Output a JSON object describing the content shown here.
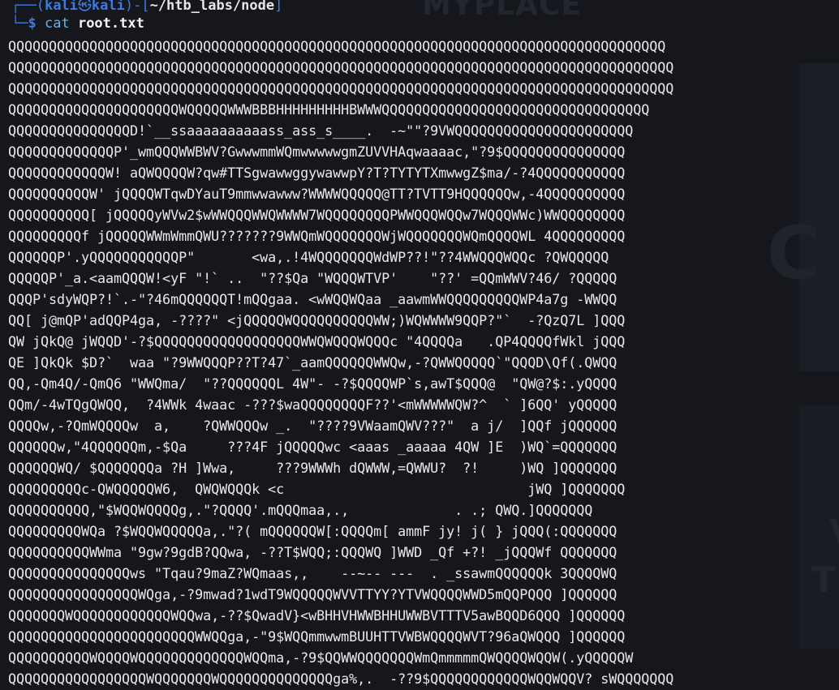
{
  "wallpaper": {
    "brand": "MYPLACE",
    "fragment_1": "C",
    "fragment_2": "V",
    "fragment_3": "TP"
  },
  "prompt": {
    "open_bracket": "┌──(",
    "user": "kali",
    "at_symbol": "㉿",
    "host": "kali",
    "mid_bracket": ")-[",
    "cwd": "~/htb_labs/node",
    "close_bracket": "]",
    "corner": "└─",
    "dollar": "$",
    "command": "cat",
    "argument": "root.txt"
  },
  "output_lines": [
    "QQQQQQQQQQQQQQQQQQQQQQQQQQQQQQQQQQQQQQQQQQQQQQQQQQQQQQQQQQQQQQQQQQQQQQQQQQQQQQQQQ",
    "QQQQQQQQQQQQQQQQQQQQQQQQQQQQQQQQQQQQQQQQQQQQQQQQQQQQQQQQQQQQQQQQQQQQQQQQQQQQQQQQQQ",
    "QQQQQQQQQQQQQQQQQQQQQQQQQQQQQQQQQQQQQQQQQQQQQQQQQQQQQQQQQQQQQQQQQQQQQQQQQQQQQQQQQQ",
    "QQQQQQQQQQQQQQQQQQQQQWQQQQQWWWBBBHHHHHHHHHBWWWQQQQQQQQQQQQQQQQQQQQQQQQQQQQQQQQQ",
    "QQQQQQQQQQQQQQQD!`__ssaaaaaaaaaass_ass_s____.  -~\"\"?9VWQQQQQQQQQQQQQQQQQQQQQQ",
    "QQQQQQQQQQQQQP'_wmQQQWWBWV?GwwwmmWQmwwwwwgmZUVVHAqwaaaac,\"?9$QQQQQQQQQQQQQQQ",
    "QQQQQQQQQQQQW! aQWQQQQW?qw#TTSgwawwggywawwpY?T?TYTYTXmwwgZ$ma/-?4QQQQQQQQQQQ",
    "QQQQQQQQQQW' jQQQQWTqwDYauT9mmwwawww?WWWWQQQQQ@TT?TVTT9HQQQQQQw,-4QQQQQQQQQQ",
    "QQQQQQQQQQ[ jQQQQQyWVw2$wWWQQQWWQWWWW7WQQQQQQQQPWWQQQWQQw7WQQQWWc)WWQQQQQQQQ",
    "QQQQQQQQQf jQQQQQWWmWmmQWU???????9WWQmWQQQQQQQWjWQQQQQQQWQmQQQQWL 4QQQQQQQQQ",
    "QQQQQQP'.yQQQQQQQQQQQP\"       <wa,.!4WQQQQQQQWdWP??!\"??4WWQQQWQQc ?QWQQQQQ",
    "QQQQQP'_a.<aamQQQW!<yF \"!` ..  \"??$Qa \"WQQQWTVP'    \"??' =QQmWWV?46/ ?QQQQQ",
    "QQQP'sdyWQP?!`.-\"?46mQQQQQQT!mQQgaa. <wWQQWQaa _aawmWWQQQQQQQQQWP4a7g -WWQQ",
    "QQ[ j@mQP'adQQP4ga, -????\" <jQQQQQWQQQQQQQQQQWW;)WQWWWW9QQP?\"`  -?QzQ7L ]QQQ",
    "QW jQkQ@ jWQQD'-?$QQQQQQQQQQQQQQQQQQWWQWQQQWQQQc \"4QQQQa   .QP4QQQQfWkl jQQQ",
    "QE ]QkQk $D?`  waa \"?9WWQQQP??T?47`_aamQQQQQQWWQw,-?QWWQQQQQ`\"QQQD\\Qf(.QWQQ",
    "QQ,-Qm4Q/-QmQ6 \"WWQma/  \"??QQQQQQL 4W\"- -?$QQQQWP`s,awT$QQQ@  \"QW@?$:.yQQQQ",
    "QQm/-4wTQgQWQQ,  ?4WWk 4waac -???$waQQQQQQQQF??'<mWWWWWQW?^  ` ]6QQ' yQQQQQ",
    "QQQQw,-?QmWQQQQw  a,    ?QWWQQQw _.  \"????9VWaamQWV???\"  a j/  ]QQf jQQQQQQ",
    "QQQQQQw,\"4QQQQQQm,-$Qa     ???4F jQQQQQwc <aaas _aaaaa 4QW ]E  )WQ`=QQQQQQQ",
    "QQQQQQWQ/ $QQQQQQQa ?H ]Wwa,     ???9WWWh dQWWW,=QWWU?  ?!     )WQ ]QQQQQQQ",
    "QQQQQQQQQc-QWQQQQQW6,  QWQWQQQk <c                              jWQ ]QQQQQQQ",
    "QQQQQQQQQQ,\"$WQQWQQQQg,.\"?QQQQ'.mQQQmaa,.,             . .; QWQ.]QQQQQQQ",
    "QQQQQQQQQWQa ?$WQQWQQQQQa,.\"?( mQQQQQQW[:QQQQm[ ammF jy! j( } jQQQ(:QQQQQQQ",
    "QQQQQQQQQQWWma \"9gw?9gdB?QQwa, -??T$WQQ;:QQQWQ ]WWD _Qf +?! _jQQQWf QQQQQQQ",
    "QQQQQQQQQQQQQQQws \"Tqau?9maZ?WQmaas,,    --~-- ---  . _ssawmQQQQQQk 3QQQQWQ",
    "QQQQQQQQQQQQQQQQWQga,-?9mwad?1wdT9WQQQQQWVVTTYY?YTVWQQQQWWD5mQQPQQQ ]QQQQQQ",
    "QQQQQQQWQQQQQQQQQQQQWQQwa,-??$QwadV}<wBHHVHWWBHHUWWBVTTTV5awBQQD6QQQ ]QQQQQQ",
    "QQQQQQQQQQQQQQQQQQQQQQQWWQQga,-\"9$WQQmmwwmBUUHTTVWBWQQQQWVT?96aQWQQQ ]QQQQQQ",
    "QQQQQQQQQQWQQQQWQQQQQQQQQQQQQWQQma,-?9$QQWWQQQQQQQWmQmmmmmQWQQQQWQQW(.yQQQQQW",
    "QQQQQQQQQQQQQQQQQWQQQQQQQWQQQQQQQQQQQQQQga%,.  -??9$QQQQQQQQQQQQWQQWQQV? sWQQQQQQQ"
  ]
}
